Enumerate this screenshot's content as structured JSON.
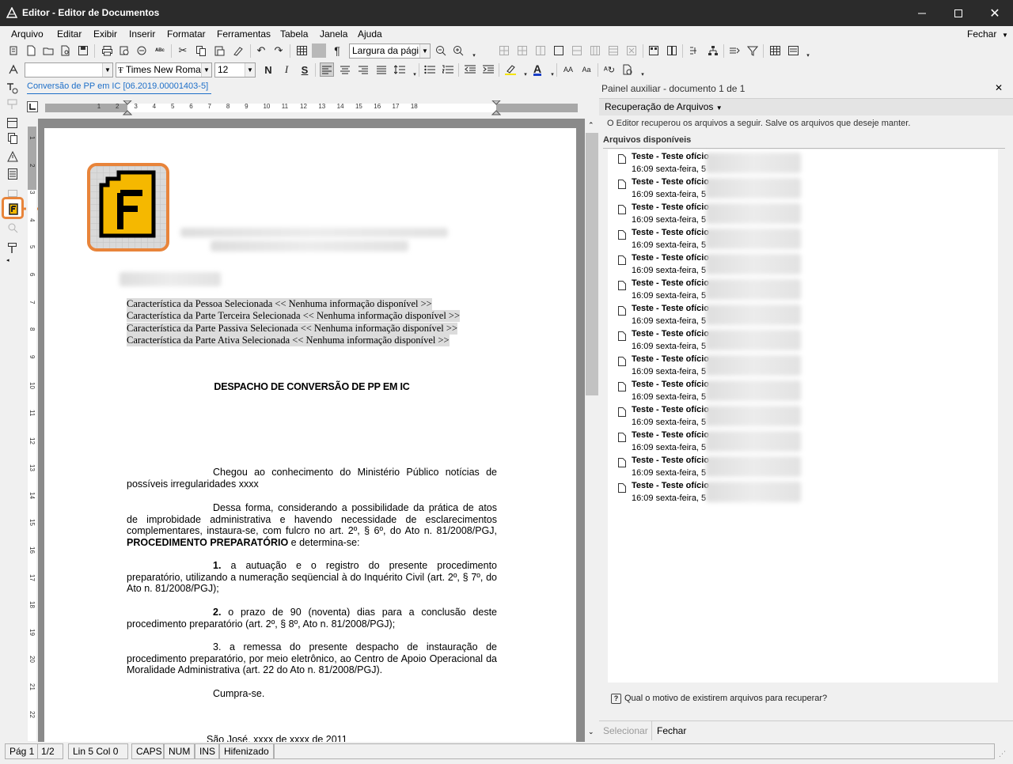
{
  "window": {
    "title": "Editor - Editor de Documentos",
    "close_glyph": "✕"
  },
  "menu": {
    "items": [
      "Arquivo",
      "Editar",
      "Exibir",
      "Inserir",
      "Formatar",
      "Ferramentas",
      "Tabela",
      "Janela",
      "Ajuda"
    ],
    "close": "Fechar"
  },
  "toolbar": {
    "zoom_value": "Largura da págir",
    "font_name": "Times New Roman",
    "font_size": "12",
    "style_value": ""
  },
  "document": {
    "tab_title": "Conversão de PP em IC [06.2019.00001403-5]",
    "characteristics": [
      "Característica da Pessoa Selecionada << Nenhuma informação disponível >>",
      "Característica da Parte Terceira Selecionada << Nenhuma informação disponível >>",
      "Característica da Parte Passiva Selecionada << Nenhuma informação disponível >>",
      "Característica da Parte Ativa Selecionada << Nenhuma informação disponível >>"
    ],
    "heading": "DESPACHO DE CONVERSÃO DE PP EM IC",
    "p1": "Chegou ao conhecimento do Ministério Público notícias de possíveis irregularidades xxxx",
    "p2_text": "Dessa forma, considerando a possibilidade da prática de atos de improbidade administrativa e havendo necessidade de esclarecimentos complementares, instaura-se, com fulcro no art. 2º, § 6º, do Ato n. 81/2008/PGJ,",
    "p2_bold": "PROCEDIMENTO PREPARATÓRIO",
    "p2_end": "e determina-se:",
    "item1_num": "1.",
    "item1": "a autuação e o registro do presente procedimento preparatório, utilizando a numeração seqüencial à do Inquérito Civil (art. 2º, § 7º, do Ato n. 81/2008/PGJ);",
    "item2_num": "2.",
    "item2": "o prazo de 90 (noventa) dias para a conclusão deste procedimento preparatório (art. 2º, § 8º, Ato n. 81/2008/PGJ);",
    "item3_num": "3.",
    "item3": "a remessa do presente despacho de instauração de procedimento preparatório, por meio eletrônico, ao Centro de Apoio Operacional da Moralidade Administrativa (art. 22 do Ato n. 81/2008/PGJ).",
    "closing": "Cumpra-se.",
    "signature_line": "São José, xxxx de xxxx  de 2011"
  },
  "ruler": {
    "marks": [
      "1",
      "2",
      "3",
      "4",
      "5",
      "6",
      "7",
      "8",
      "9",
      "10",
      "11",
      "12",
      "13",
      "14",
      "15",
      "16",
      "17",
      "18"
    ],
    "vmarks": [
      "1",
      "2",
      "3",
      "4",
      "5",
      "6",
      "7",
      "8",
      "9",
      "10",
      "11",
      "12",
      "13",
      "14",
      "15",
      "16",
      "17",
      "18",
      "19",
      "20",
      "21",
      "22"
    ]
  },
  "panel": {
    "title": "Painel auxiliar - documento 1 de 1",
    "section": "Recuperação de Arquivos",
    "info": "O Editor recuperou os arquivos a seguir. Salve os arquivos que deseje manter.",
    "list_header": "Arquivos disponíveis",
    "files": [
      {
        "name": "Teste - Teste ofício",
        "date": "16:09 sexta-feira, 5"
      },
      {
        "name": "Teste - Teste ofício",
        "date": "16:09 sexta-feira, 5"
      },
      {
        "name": "Teste - Teste ofício",
        "date": "16:09 sexta-feira, 5"
      },
      {
        "name": "Teste - Teste ofício",
        "date": "16:09 sexta-feira, 5"
      },
      {
        "name": "Teste - Teste ofício",
        "date": "16:09 sexta-feira, 5"
      },
      {
        "name": "Teste - Teste ofício",
        "date": "16:09 sexta-feira, 5"
      },
      {
        "name": "Teste - Teste ofício",
        "date": "16:09 sexta-feira, 5"
      },
      {
        "name": "Teste - Teste ofício",
        "date": "16:09 sexta-feira, 5"
      },
      {
        "name": "Teste - Teste ofício",
        "date": "16:09 sexta-feira, 5"
      },
      {
        "name": "Teste - Teste ofício",
        "date": "16:09 sexta-feira, 5"
      },
      {
        "name": "Teste - Teste ofício",
        "date": "16:09 sexta-feira, 5"
      },
      {
        "name": "Teste - Teste ofício",
        "date": "16:09 sexta-feira, 5"
      },
      {
        "name": "Teste - Teste ofício",
        "date": "16:09 sexta-feira, 5"
      },
      {
        "name": "Teste - Teste ofício",
        "date": "16:09 sexta-feira, 5"
      }
    ],
    "help_link": "Qual o motivo de existirem arquivos para recuperar?",
    "select_button": "Selecionar",
    "close_button": "Fechar"
  },
  "status": {
    "page": "Pág 1",
    "pages": "1/2",
    "position": "Lin 5  Col 0",
    "caps": "CAPS",
    "num": "NUM",
    "ins": "INS",
    "hyphen": "Hifenizado"
  },
  "colors": {
    "accent": "#e8843a",
    "logo_yellow": "#f5b800",
    "link": "#1e6fc8"
  }
}
